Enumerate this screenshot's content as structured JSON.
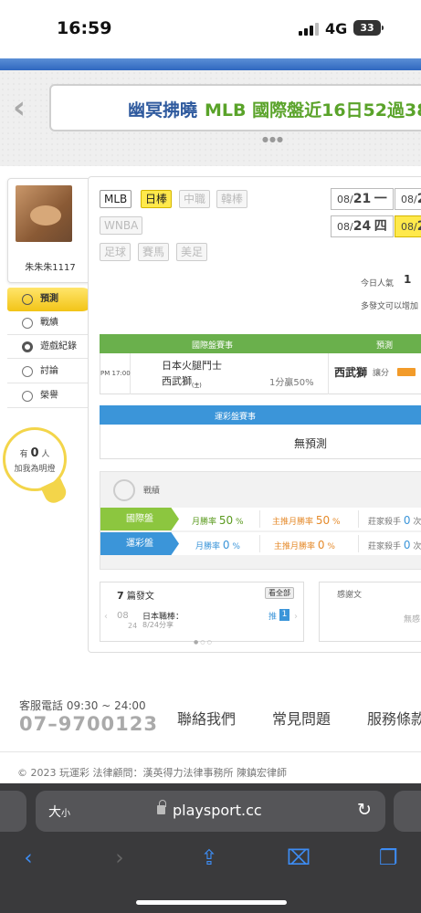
{
  "status_bar": {
    "time": "16:59",
    "network": "4G",
    "battery": "33"
  },
  "banner": {
    "title_part1": "幽冥拂曉",
    "title_part2": "MLB 國際盤近16日52過38",
    "pager": "●●●"
  },
  "profile": {
    "username": "朱朱朱1117"
  },
  "sidebar": {
    "items": [
      {
        "label": "預測",
        "icon": "target-icon",
        "active": true
      },
      {
        "label": "戰績",
        "icon": "chat-icon"
      },
      {
        "label": "遊戲紀錄",
        "icon": "circle-icon"
      },
      {
        "label": "討論",
        "icon": "magnifier-icon"
      },
      {
        "label": "榮譽",
        "icon": "medal-icon"
      }
    ]
  },
  "fans": {
    "prefix": "有",
    "count": "0",
    "suffix": "人",
    "line2": "加我為明燈"
  },
  "leagues": [
    {
      "label": "MLB",
      "state": "on"
    },
    {
      "label": "日棒",
      "state": "selected"
    },
    {
      "label": "中職",
      "state": "off"
    },
    {
      "label": "韓棒",
      "state": "off"
    },
    {
      "label": "WNBA",
      "state": "off"
    },
    {
      "label": "足球",
      "state": "off"
    },
    {
      "label": "賽馬",
      "state": "off"
    },
    {
      "label": "美足",
      "state": "off"
    }
  ],
  "dates": [
    {
      "prefix": "08/",
      "day": "21",
      "weekday": "一"
    },
    {
      "prefix": "08/",
      "day": "2",
      "weekday": ""
    },
    {
      "prefix": "08/",
      "day": "24",
      "weekday": "四"
    },
    {
      "prefix": "08/",
      "day": "2",
      "weekday": ""
    }
  ],
  "popularity": {
    "label": "今日人氣",
    "value": "1",
    "note": "多發文可以增加"
  },
  "intl_table": {
    "header_event": "國際盤賽事",
    "header_predict": "預測",
    "game": {
      "time": "PM 17:00",
      "home": "日本火腿鬥士",
      "away": "西武獅",
      "away_mark": "(主)",
      "line": "1分贏50%",
      "pick": "西武獅",
      "pick_type": "讓分"
    }
  },
  "lottery_table": {
    "header_event": "運彩盤賽事",
    "empty": "無預測"
  },
  "record": {
    "title": "戰績",
    "intl": {
      "label": "國際盤",
      "c1_label": "月勝率",
      "c1_val": "50",
      "c2_label": "主推月勝率",
      "c2_val": "50",
      "c3_label": "莊家殺手",
      "c3_val": "0"
    },
    "lottery": {
      "label": "運彩盤",
      "c1_label": "月勝率",
      "c1_val": "0",
      "c2_label": "主推月勝率",
      "c2_val": "0",
      "c3_label": "莊家殺手",
      "c3_val": "0"
    },
    "unit": "%",
    "unit2": "次"
  },
  "posts": {
    "count": "7",
    "count_label": "篇發文",
    "view_all": "看全部",
    "date_month": "08",
    "date_day": "24",
    "league": "日本職棒：",
    "date_text": "8/24分享",
    "push_label": "推",
    "push_count": "1"
  },
  "thanks": {
    "title": "感謝文",
    "empty": "無感"
  },
  "footer": {
    "cs_label": "客服電話 09:30 ~ 24:00",
    "cs_phone": "07–9700123",
    "links": [
      "聯絡我們",
      "常見問題",
      "服務條款"
    ],
    "copyright": "© 2023 玩運彩 法律顧問：漢英得力法律事務所 陳鎮宏律師"
  },
  "browser": {
    "text_size": "大",
    "text_size_small": "小",
    "url": "playsport.cc"
  }
}
